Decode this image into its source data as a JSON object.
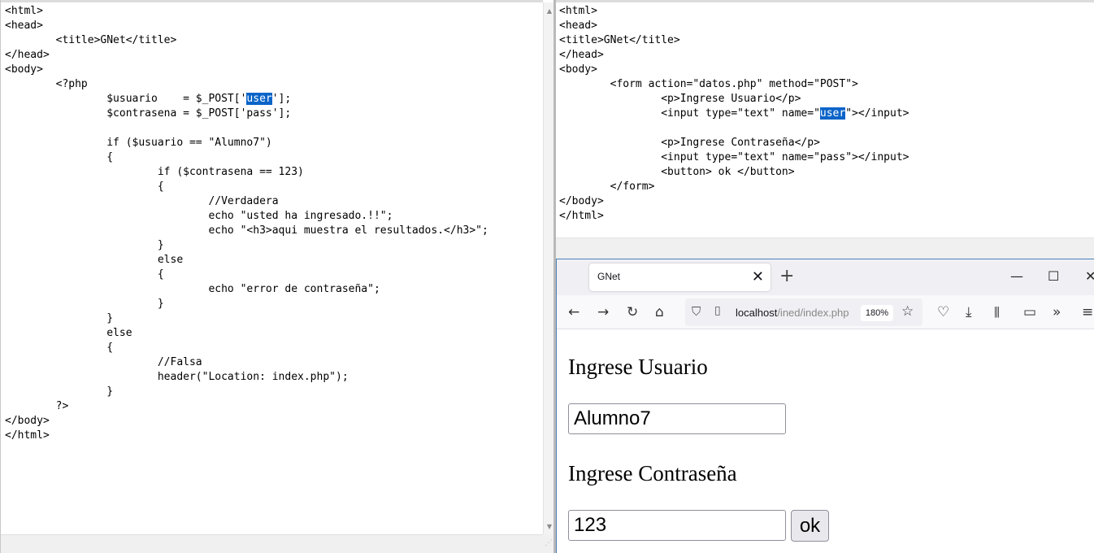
{
  "left_editor": {
    "lines": [
      [
        "<html>"
      ],
      [
        "<head>"
      ],
      [
        "        <title>GNet</title>"
      ],
      [
        "</head>"
      ],
      [
        "<body>"
      ],
      [
        "        <?php"
      ],
      [
        "                $usuario    = $_POST['",
        "user",
        "'];"
      ],
      [
        "                $contrasena = $_POST['pass'];"
      ],
      [
        ""
      ],
      [
        "                if ($usuario == \"Alumno7\")"
      ],
      [
        "                {"
      ],
      [
        "                        if ($contrasena == 123)"
      ],
      [
        "                        {"
      ],
      [
        "                                //Verdadera"
      ],
      [
        "                                echo \"usted ha ingresado.!!\";"
      ],
      [
        "                                echo \"<h3>aqui muestra el resultados.</h3>\";"
      ],
      [
        "                        }"
      ],
      [
        "                        else"
      ],
      [
        "                        {"
      ],
      [
        "                                echo \"error de contraseña\";"
      ],
      [
        "                        }"
      ],
      [
        "                }"
      ],
      [
        "                else"
      ],
      [
        "                {"
      ],
      [
        "                        //Falsa"
      ],
      [
        "                        header(\"Location: index.php\");"
      ],
      [
        "                }"
      ],
      [
        "        ?>"
      ],
      [
        "</body>"
      ],
      [
        "</html>"
      ]
    ]
  },
  "right_editor": {
    "lines": [
      [
        "<html>"
      ],
      [
        "<head>"
      ],
      [
        "<title>GNet</title>"
      ],
      [
        "</head>"
      ],
      [
        "<body>"
      ],
      [
        "        <form action=\"datos.php\" method=\"POST\">"
      ],
      [
        "                <p>Ingrese Usuario</p>"
      ],
      [
        "                <input type=\"text\" name=\"",
        "user",
        "\"></input>"
      ],
      [
        ""
      ],
      [
        "                <p>Ingrese Contraseña</p>"
      ],
      [
        "                <input type=\"text\" name=\"pass\"></input>"
      ],
      [
        "                <button> ok </button>"
      ],
      [
        "        </form>"
      ],
      [
        "</body>"
      ],
      [
        "</html>"
      ]
    ]
  },
  "browser": {
    "tab_title": "GNet",
    "tab_close": "✕",
    "new_tab": "+",
    "window_buttons": {
      "minimize": "—",
      "maximize": "☐",
      "close": "✕"
    },
    "url": {
      "host": "localhost",
      "path": "/ined/index.php"
    },
    "zoom": "180%",
    "icons": [
      "back-icon",
      "forward-icon",
      "reload-icon",
      "home-icon",
      "shield-icon",
      "page-icon",
      "star-icon",
      "pocket-icon",
      "download-icon",
      "library-icon",
      "sidebar-icon",
      "overflow-icon",
      "menu-icon"
    ],
    "page": {
      "usuario_label": "Ingrese Usuario",
      "usuario_value": "Alumno7",
      "contrasena_label": "Ingrese Contraseña",
      "contrasena_value": "123",
      "ok_button": "ok"
    }
  },
  "colors": {
    "selection": "#0a64c8",
    "browser_tab_bar": "#f0f0f4",
    "window_border": "#4a7fb8"
  }
}
